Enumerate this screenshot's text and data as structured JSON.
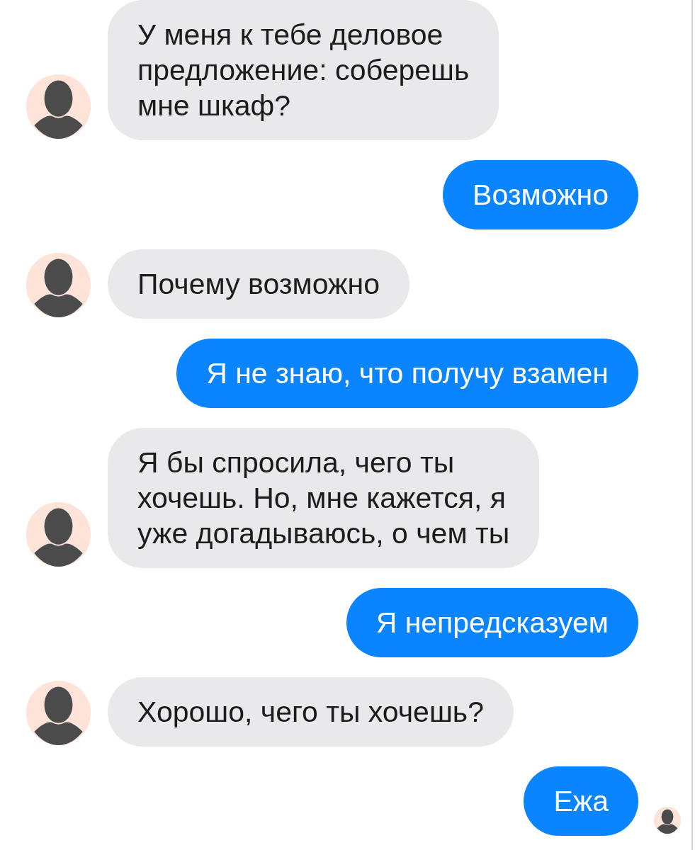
{
  "messages": [
    {
      "kind": "incoming",
      "text": "У меня к тебе деловое\nпредложение: соберешь\nмне шкаф?"
    },
    {
      "kind": "outgoing",
      "text": "Возможно",
      "seen": false
    },
    {
      "kind": "incoming",
      "text": "Почему возможно"
    },
    {
      "kind": "outgoing",
      "text": "Я не знаю, что получу взамен",
      "seen": false
    },
    {
      "kind": "incoming",
      "text": "Я бы спросила, чего ты\nхочешь. Но, мне кажется, я\nуже догадываюсь, о чем ты"
    },
    {
      "kind": "outgoing",
      "text": "Я непредсказуем",
      "seen": false
    },
    {
      "kind": "incoming",
      "text": "Хорошо, чего ты хочешь?"
    },
    {
      "kind": "outgoing",
      "text": "Ежа",
      "seen": true
    }
  ]
}
